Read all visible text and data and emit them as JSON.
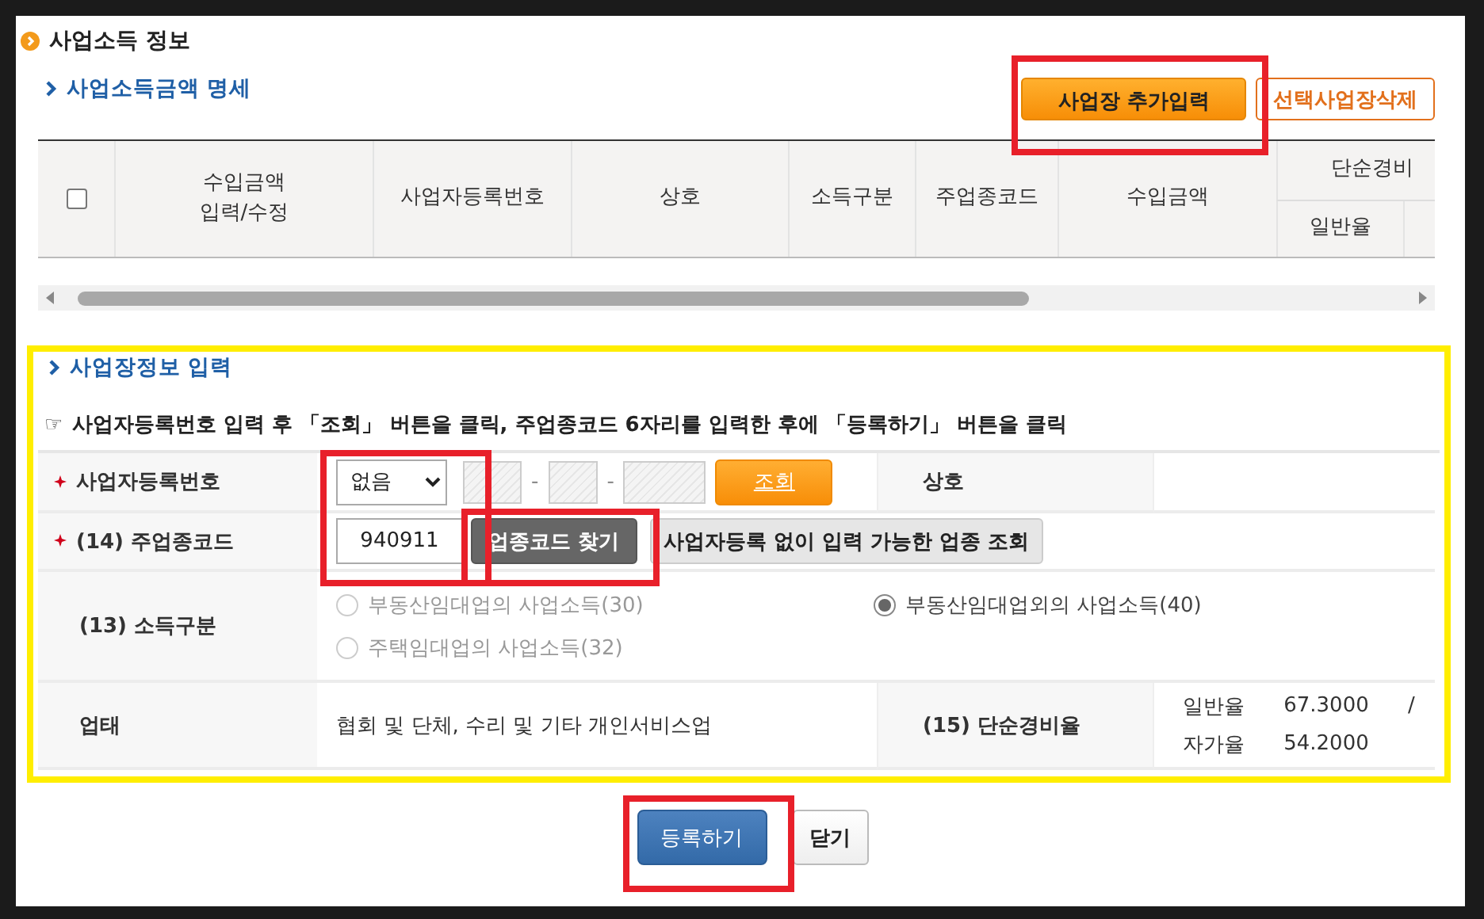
{
  "section_title": "사업소득 정보",
  "income_list": {
    "heading": "사업소득금액 명세",
    "buttons": [
      {
        "label": "사업장 추가입력",
        "kind": "primary",
        "highlighted": true
      },
      {
        "label": "선택사업장삭제",
        "kind": "outline",
        "highlighted": false
      }
    ],
    "table": {
      "select_all_checked": false,
      "columns": [
        {
          "label": "수입금액\n입력/수정"
        },
        {
          "label": "사업자등록번호"
        },
        {
          "label": "상호"
        },
        {
          "label": "소득구분"
        },
        {
          "label": "주업종코드"
        },
        {
          "label": "수입금액"
        },
        {
          "label": "단순경비",
          "children": [
            "일반율"
          ]
        }
      ]
    }
  },
  "entry_form": {
    "heading": "사업장정보 입력",
    "highlighted": true,
    "instruction_icon": "☞",
    "instruction": "사업자등록번호 입력 후 「조회」 버튼을 클릭, 주업종코드 6자리를 입력한 후에 「등록하기」 버튼을 클릭",
    "business_number": {
      "label": "사업자등록번호",
      "required": true,
      "select": {
        "value": "없음"
      },
      "separator": "-",
      "lookup_button": "조회",
      "trade_name_label": "상호"
    },
    "industry_code": {
      "label": "(14) 주업종코드",
      "required": true,
      "value": "940911",
      "highlighted": true,
      "find_button": {
        "label": "업종코드 찾기",
        "highlighted": true
      },
      "lookup_button": "사업자등록 없이 입력 가능한 업종 조회"
    },
    "income_type": {
      "label": "(13) 소득구분",
      "options": [
        {
          "label": "부동산임대업의 사업소득(30)",
          "selected": false,
          "disabled": true
        },
        {
          "label": "부동산임대업외의 사업소득(40)",
          "selected": true,
          "disabled": false
        },
        {
          "label": "주택임대업의 사업소득(32)",
          "selected": false,
          "disabled": true
        }
      ]
    },
    "business_type": {
      "label": "업태",
      "value": "협회 및 단체, 수리 및 기타 개인서비스업",
      "rate_label": "(15) 단순경비율",
      "rates": [
        {
          "label": "일반율",
          "value": "67.3000",
          "separator": "/"
        },
        {
          "label": "자가율",
          "value": "54.2000"
        }
      ]
    }
  },
  "footer_buttons": [
    {
      "label": "등록하기",
      "kind": "primary",
      "highlighted": true
    },
    {
      "label": "닫기",
      "kind": "default",
      "highlighted": false
    }
  ]
}
